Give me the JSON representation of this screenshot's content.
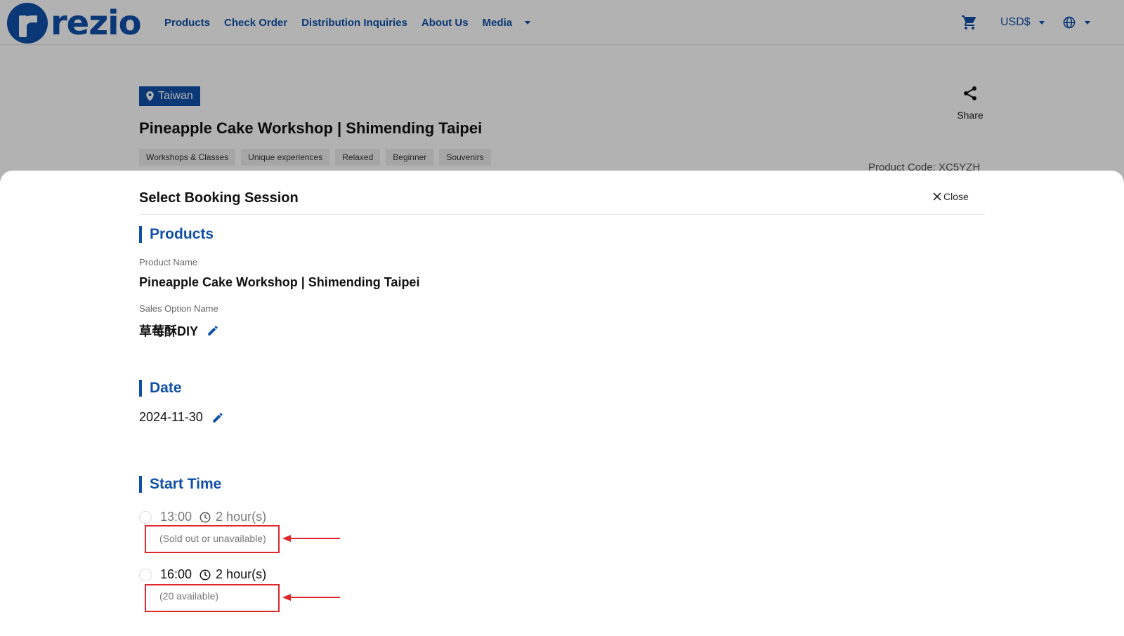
{
  "header": {
    "logo_text": "rezio",
    "nav": [
      "Products",
      "Check Order",
      "Distribution Inquiries",
      "About Us",
      "Media"
    ],
    "currency": "USD$",
    "icons": [
      "cart-icon",
      "globe-icon",
      "chevron-down-icon"
    ]
  },
  "product": {
    "location": "Taiwan",
    "title": "Pineapple Cake Workshop | Shimending Taipei",
    "tags": [
      "Workshops & Classes",
      "Unique experiences",
      "Relaxed",
      "Beginner",
      "Souvenirs"
    ],
    "share_label": "Share",
    "product_code": "Product Code: XC5YZH"
  },
  "modal": {
    "title": "Select Booking Session",
    "close_label": "Close",
    "products_heading": "Products",
    "product_name_label": "Product Name",
    "product_name": "Pineapple Cake Workshop | Shimending Taipei",
    "sales_option_label": "Sales Option Name",
    "sales_option": "草莓酥DIY",
    "date_heading": "Date",
    "date_value": "2024-11-30",
    "start_time_heading": "Start Time",
    "sessions": [
      {
        "time": "13:00",
        "duration": "2 hour(s)",
        "availability": "(Sold out or unavailable)",
        "enabled": false
      },
      {
        "time": "16:00",
        "duration": "2 hour(s)",
        "availability": "(20 available)",
        "enabled": true
      }
    ]
  },
  "colors": {
    "brand": "#0f4fa8",
    "annotation": "#e0262a",
    "overlay": "rgba(0,0,0,0.30)"
  }
}
